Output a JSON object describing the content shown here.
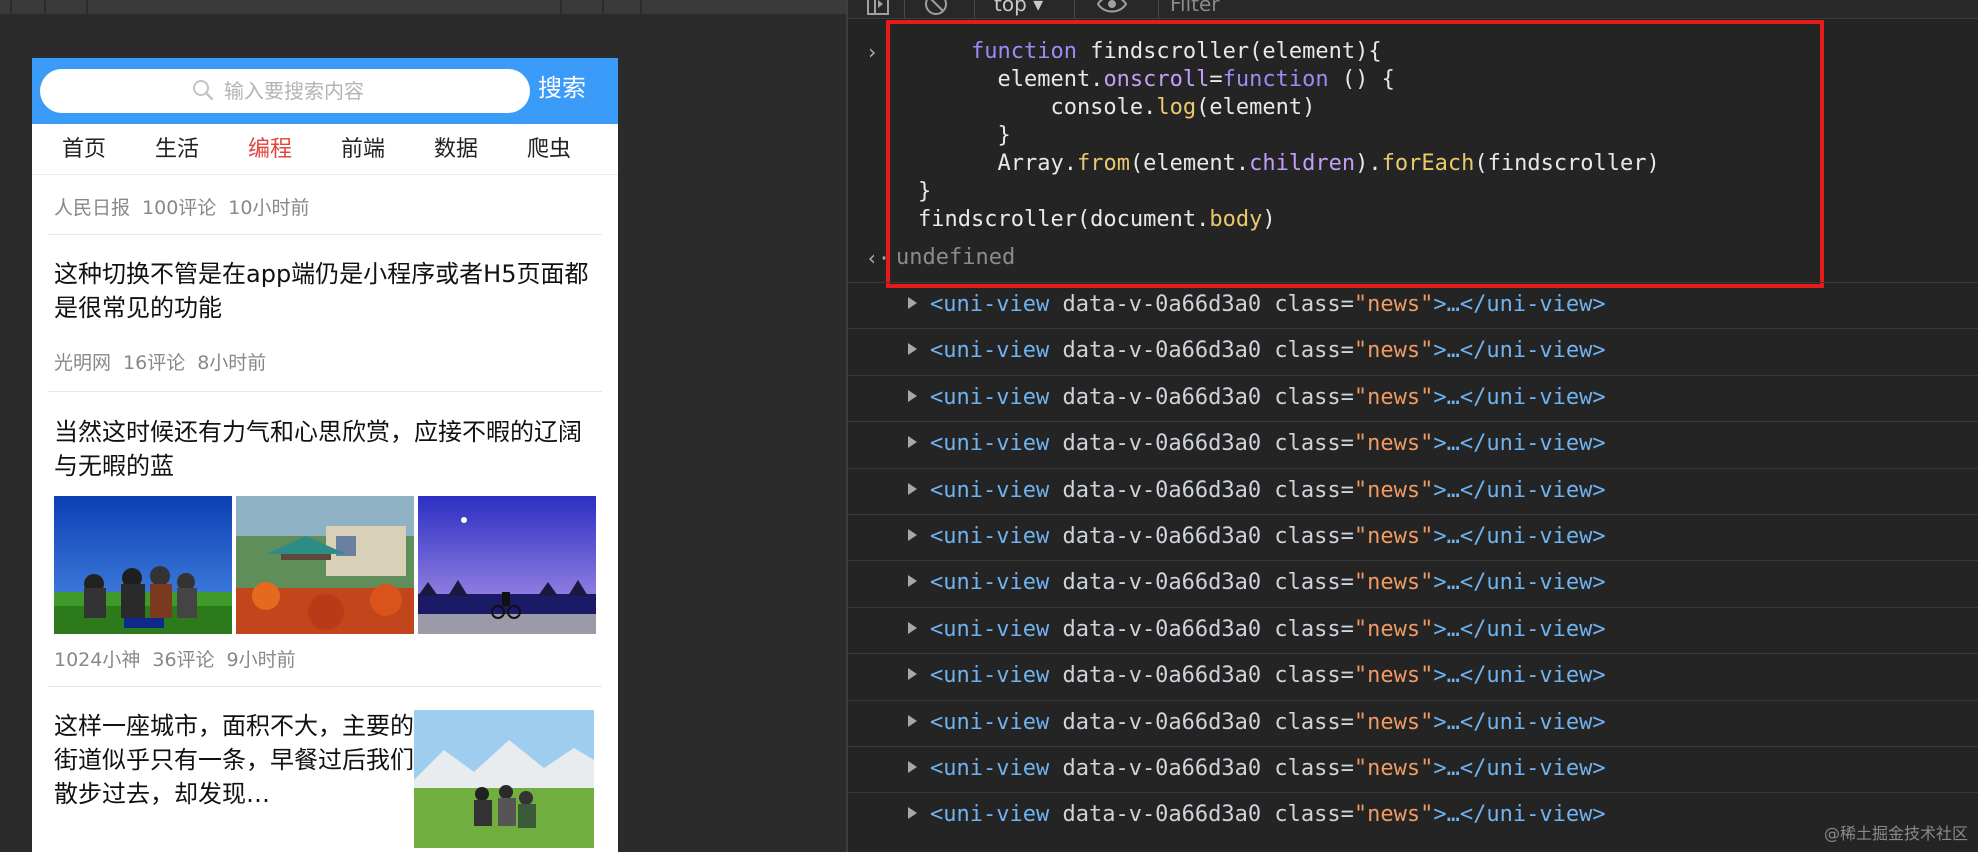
{
  "left": {
    "search": {
      "placeholder": "输入要搜索内容",
      "button": "搜索"
    },
    "tabs": [
      "首页",
      "生活",
      "编程",
      "前端",
      "数据",
      "爬虫"
    ],
    "active_tab": "编程",
    "news": [
      {
        "meta": [
          "人民日报",
          "100评论",
          "10小时前"
        ]
      },
      {
        "title": "这种切换不管是在app端仍是小程序或者H5页面都是很常见的功能",
        "meta": [
          "光明网",
          "16评论",
          "8小时前"
        ]
      },
      {
        "title": "当然这时候还有力气和心思欣赏，应接不暇的辽阔与无暇的蓝",
        "meta": [
          "1024小神",
          "36评论",
          "9小时前"
        ]
      },
      {
        "title": "这样一座城市，面积不大，主要的街道似乎只有一条，早餐过后我们散步过去，却发现…"
      }
    ]
  },
  "devtools": {
    "toolbar": {
      "context": "top ▾",
      "filter": "Filter"
    },
    "code_lines": [
      "    function findscroller(element){",
      "      element.onscroll=function () {",
      "          console.log(element)",
      "      }",
      "      Array.from(element.children).forEach(findscroller)",
      "}",
      "findscroller(document.body)"
    ],
    "result": "undefined",
    "element_row": {
      "open": "<uni-view",
      "attr": "data-v-0a66d3a0",
      "class_attr": "class=",
      "class_value": "\"news\"",
      "close": ">…</uni-view>"
    },
    "row_count": 12
  },
  "watermark": "@稀土掘金技术社区",
  "colors": {
    "header_blue": "#3a9bf9",
    "active_tab": "#e0463d",
    "highlight_box": "#e51b1b",
    "console_bg": "#242424"
  }
}
